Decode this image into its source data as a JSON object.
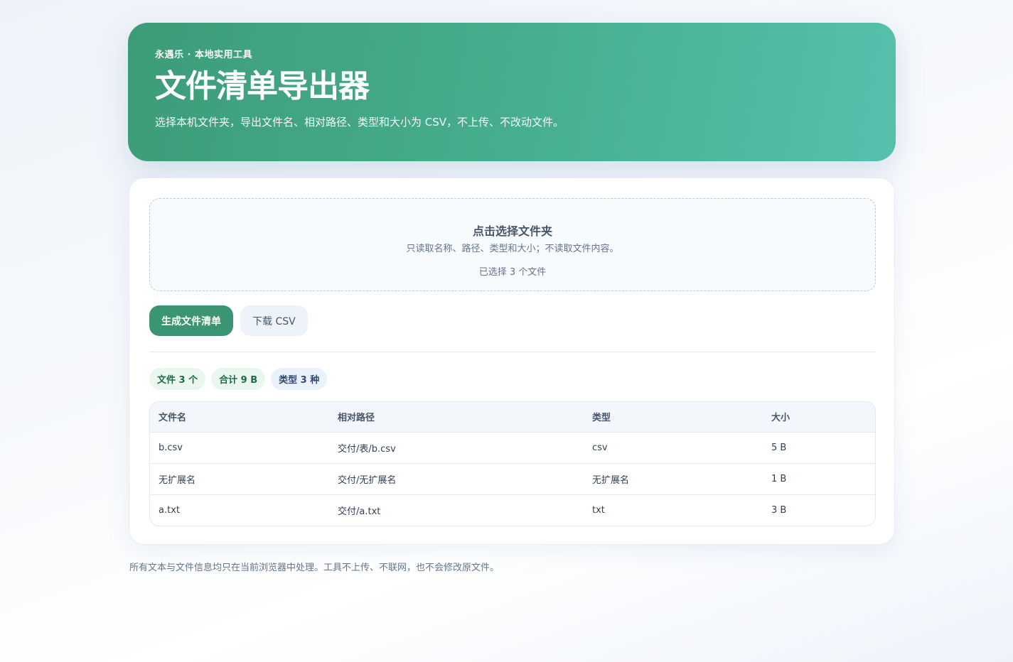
{
  "hero": {
    "eyebrow": "永遇乐 · 本地实用工具",
    "title": "文件清单导出器",
    "subtitle": "选择本机文件夹，导出文件名、相对路径、类型和大小为 CSV，不上传、不改动文件。"
  },
  "dropzone": {
    "title": "点击选择文件夹",
    "description": "只读取名称、路径、类型和大小；不读取文件内容。",
    "status": "已选择 3 个文件"
  },
  "actions": {
    "generate_label": "生成文件清单",
    "download_label": "下载 CSV"
  },
  "stats": {
    "files": "文件 3 个",
    "total": "合计 9 B",
    "types": "类型 3 种"
  },
  "table": {
    "headers": [
      "文件名",
      "相对路径",
      "类型",
      "大小"
    ],
    "rows": [
      [
        "b.csv",
        "交付/表/b.csv",
        "csv",
        "5 B"
      ],
      [
        "无扩展名",
        "交付/无扩展名",
        "无扩展名",
        "1 B"
      ],
      [
        "a.txt",
        "交付/a.txt",
        "txt",
        "3 B"
      ]
    ]
  },
  "footer": {
    "note": "所有文本与文件信息均只在当前浏览器中处理。工具不上传、不联网，也不会修改原文件。"
  },
  "colors": {
    "accent": "#3b9573",
    "hero_start": "#3d9c78",
    "hero_end": "#57c0ad"
  }
}
